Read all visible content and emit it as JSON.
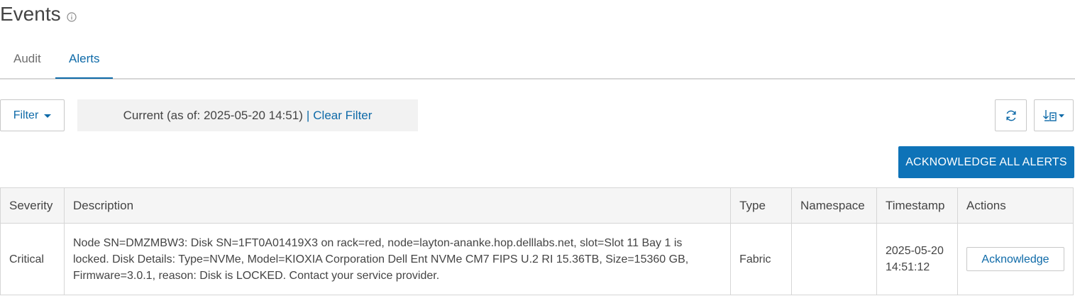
{
  "header": {
    "title": "Events",
    "info_icon": "info-circle-icon"
  },
  "tabs": [
    {
      "label": "Audit",
      "active": false
    },
    {
      "label": "Alerts",
      "active": true
    }
  ],
  "toolbar": {
    "filter_label": "Filter",
    "filter_status": "Current (as of: 2025-05-20 14:51)",
    "separator": "|",
    "clear_filter_label": "Clear Filter",
    "refresh_icon": "refresh-icon",
    "export_icon": "export-icon",
    "acknowledge_all_label": "ACKNOWLEDGE ALL ALERTS"
  },
  "table": {
    "columns": [
      "Severity",
      "Description",
      "Type",
      "Namespace",
      "Timestamp",
      "Actions"
    ],
    "rows": [
      {
        "severity": "Critical",
        "description": "Node SN=DMZMBW3: Disk SN=1FT0A01419X3 on rack=red, node=layton-ananke.hop.delllabs.net, slot=Slot 11 Bay 1 is locked. Disk Details: Type=NVMe, Model=KIOXIA Corporation Dell Ent NVMe CM7 FIPS U.2 RI 15.36TB, Size=15360 GB, Firmware=3.0.1, reason: Disk is LOCKED. Contact your service provider.",
        "type": "Fabric",
        "namespace": "",
        "timestamp_date": "2025-05-20",
        "timestamp_time": "14:51:12",
        "action_label": "Acknowledge"
      }
    ]
  },
  "colors": {
    "accent": "#0e6aa8",
    "primary_button": "#0e73b8"
  }
}
